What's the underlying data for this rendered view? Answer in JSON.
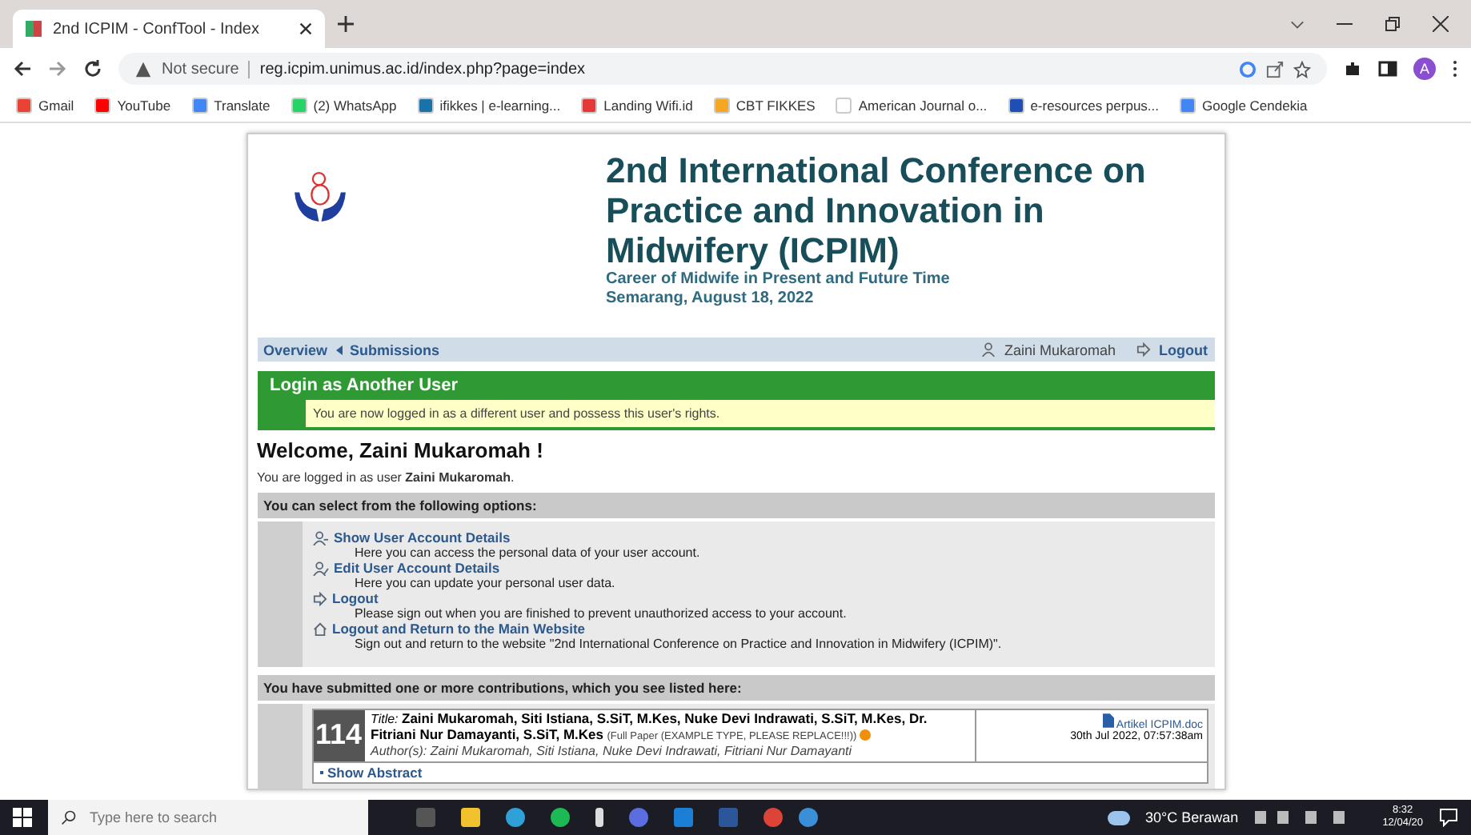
{
  "browser": {
    "tab": {
      "title": "2nd ICPIM - ConfTool - Index",
      "selected": true
    },
    "security": "Not secure",
    "url": "reg.icpim.unimus.ac.id/index.php?page=index",
    "profile_initial": "A",
    "bookmarks": [
      {
        "label": "Gmail",
        "color": "#ea4335"
      },
      {
        "label": "YouTube",
        "color": "#ff0000"
      },
      {
        "label": "Translate",
        "color": "#4285f4"
      },
      {
        "label": "(2) WhatsApp",
        "color": "#25d366"
      },
      {
        "label": "ifikkes | e-learning...",
        "color": "#1a73a8"
      },
      {
        "label": "Landing Wifi.id",
        "color": "#e53935"
      },
      {
        "label": "CBT FIKKES",
        "color": "#f5a623"
      },
      {
        "label": "American Journal o...",
        "color": "#ffffff"
      },
      {
        "label": "e-resources perpus...",
        "color": "#1e4fb5"
      },
      {
        "label": "Google Cendekia",
        "color": "#4285f4"
      }
    ]
  },
  "header": {
    "title": "2nd International Conference on Practice and Innovation in Midwifery (ICPIM)",
    "subtitle": "Career of Midwife in Present and Future Time",
    "place_date": "Semarang, August 18, 2022"
  },
  "nav": {
    "items": [
      {
        "label": "Overview",
        "kind": "plain"
      },
      {
        "label": "Submissions",
        "kind": "caret"
      }
    ],
    "user": "Zaini Mukaromah",
    "logout": "Logout"
  },
  "notice": {
    "title": "Login as Another User",
    "message": "You are now logged in as a different user and possess this user's rights."
  },
  "welcome": "Welcome, Zaini Mukaromah !",
  "logged_in": "You are logged in as user **Zaini Mukaromah**.",
  "options": {
    "heading": "You can select from the following options:",
    "items": [
      {
        "kind": "user",
        "label": "Show User Account Details",
        "description": "Here you can access the personal data of your user account."
      },
      {
        "kind": "edit",
        "label": "Edit User Account Details",
        "description": "Here you can update your personal user data."
      },
      {
        "kind": "logout",
        "label": "Logout",
        "description": "Please sign out when you are finished to prevent unauthorized access to your account."
      },
      {
        "kind": "home",
        "label": "Logout and Return to the Main Website",
        "description": "Sign out and return to the website \"2nd International Conference on Practice and Innovation in Midwifery (ICPIM)\"."
      }
    ]
  },
  "contributions": {
    "heading": "You have submitted one or more contributions, which you see listed here:",
    "items": [
      {
        "number": "114",
        "title_label": "Title:",
        "title": "Zaini Mukaromah, Siti Istiana, S.SiT, M.Kes, Nuke Devi Indrawati, S.SiT, M.Kes, Dr. Fitriani Nur Damayanti, S.SiT, M.Kes",
        "type": "(Full Paper (EXAMPLE TYPE, PLEASE REPLACE!!!))",
        "authors": "Author(s): Zaini Mukaromah, Siti Istiana, Nuke Devi Indrawati, Fitriani Nur Damayanti",
        "file": "Artikel ICPIM.doc",
        "date": "30th Jul 2022, 07:57:38am",
        "abstract_link": "Show Abstract"
      }
    ]
  },
  "taskbar": {
    "search_placeholder": "Type here to search",
    "weather": "30°C  Berawan",
    "time": "8:32",
    "date": "12/04/20"
  }
}
